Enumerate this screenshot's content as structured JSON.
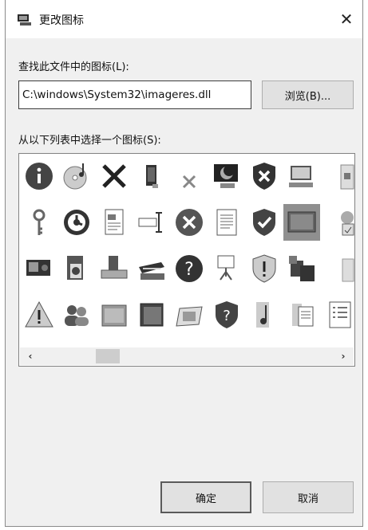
{
  "dialog": {
    "title": "更改图标",
    "close_glyph": "✕"
  },
  "search": {
    "label": "查找此文件中的图标(L):",
    "value": "C:\\windows\\System32\\imageres.dll",
    "browse_label": "浏览(B)..."
  },
  "icon_list": {
    "label": "从以下列表中选择一个图标(S):",
    "selected_index": 16,
    "icons": [
      "info-icon",
      "cd-music-icon",
      "x-mark-icon",
      "phone-device-icon",
      "small-x-icon",
      "monitor-moon-icon",
      "shield-x-icon",
      "computer-icon",
      "document-partial-icon",
      "key-icon",
      "clock-dial-icon",
      "document-image-icon",
      "ibeam-tool-icon",
      "error-circle-icon",
      "text-document-icon",
      "shield-check-icon",
      "monitor-panel-icon",
      "gear-doc-icon",
      "video-card-icon",
      "speaker-doc-icon",
      "drive-install-icon",
      "scanner-icon",
      "help-circle-icon",
      "presentation-board-icon",
      "shield-exclamation-icon",
      "programs-icon",
      "document-partial-2-icon",
      "warning-triangle-icon",
      "users-icon",
      "folder-panel-icon",
      "dark-panel-icon",
      "slide-frame-icon",
      "shield-help-icon",
      "music-doc-icon",
      "doc-sheet-icon",
      "list-doc-icon"
    ],
    "scroll_left": "‹",
    "scroll_right": "›"
  },
  "footer": {
    "ok_label": "确定",
    "cancel_label": "取消"
  }
}
